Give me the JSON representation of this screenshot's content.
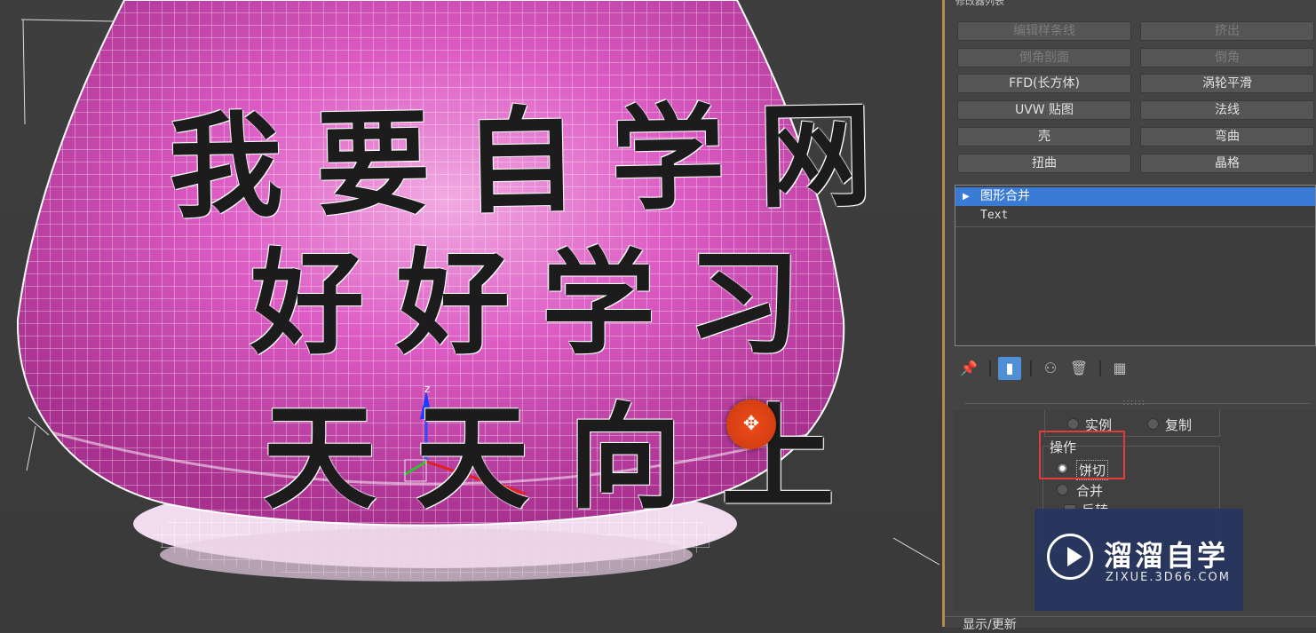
{
  "viewport": {
    "carved_text_lines": [
      "我要自学网",
      "好好学习",
      "天天向上"
    ],
    "gizmo_axis_z": "z",
    "cursor_icon": "move-cursor-icon"
  },
  "panel": {
    "top_title": "修改器列表",
    "modifier_buttons": [
      {
        "label": "编辑样条线",
        "enabled": false
      },
      {
        "label": "挤出",
        "enabled": false
      },
      {
        "label": "倒角剖面",
        "enabled": false
      },
      {
        "label": "倒角",
        "enabled": false
      },
      {
        "label": "FFD(长方体)",
        "enabled": true
      },
      {
        "label": "涡轮平滑",
        "enabled": true
      },
      {
        "label": "UVW 贴图",
        "enabled": true
      },
      {
        "label": "法线",
        "enabled": true
      },
      {
        "label": "壳",
        "enabled": true
      },
      {
        "label": "弯曲",
        "enabled": true
      },
      {
        "label": "扭曲",
        "enabled": true
      },
      {
        "label": "晶格",
        "enabled": true
      }
    ],
    "stack": {
      "selected_item": "图形合并",
      "item": "Text"
    },
    "toolbar_icons": [
      "pin-stack-icon",
      "show-end-result-icon",
      "make-unique-icon",
      "remove-modifier-icon",
      "configure-modifier-sets-icon"
    ],
    "rollout": {
      "copy_mode": {
        "instance_label": "实例",
        "copy_label": "复制"
      },
      "operation": {
        "group_label": "操作",
        "options": [
          {
            "label": "饼切",
            "selected": true
          },
          {
            "label": "合并",
            "selected": false
          }
        ],
        "partial_option": "反转"
      },
      "footer_label": "显示/更新"
    }
  },
  "watermark": {
    "title": "溜溜自学",
    "url": "ZIXUE.3D66.COM"
  },
  "colors": {
    "object_pink": "#d454b8",
    "selection_blue": "#3a7bd5",
    "highlight_red": "#e03c3c",
    "divider_gold": "#b38c4a"
  }
}
